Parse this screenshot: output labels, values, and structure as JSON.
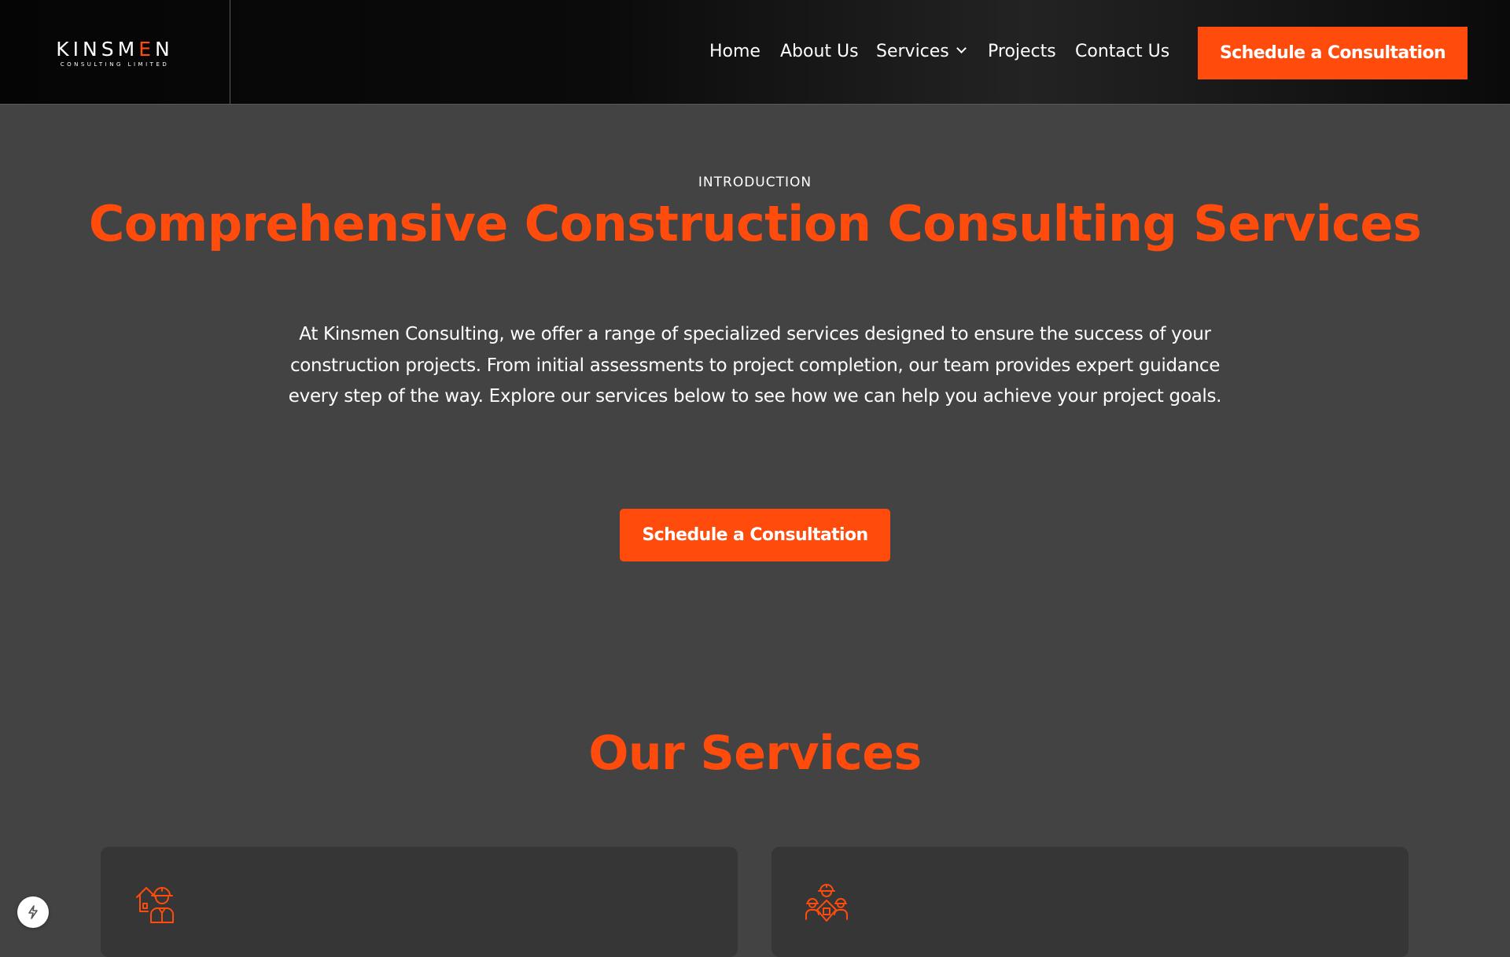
{
  "header": {
    "logo": {
      "word_start": "KINSM",
      "word_mid": "E",
      "word_end": "N",
      "tagline": "CONSULTING LIMITED"
    },
    "nav": [
      {
        "label": "Home"
      },
      {
        "label": "About Us"
      },
      {
        "label": "Services",
        "icon": "chevron-down-icon"
      },
      {
        "label": "Projects"
      },
      {
        "label": "Contact Us"
      }
    ],
    "cta_label": "Schedule a Consultation"
  },
  "hero": {
    "eyebrow": "INTRODUCTION",
    "title": "Comprehensive Construction Consulting Services",
    "paragraph": "At Kinsmen Consulting, we offer a range of specialized services designed to ensure the success of your construction projects. From initial assessments to project completion, our team provides expert guidance every step of the way. Explore our services below to see how we can help you achieve your project goals.",
    "cta_label": "Schedule a Consultation"
  },
  "services": {
    "title": "Our Services",
    "cards": [
      {
        "icon": "construction-worker-house-icon"
      },
      {
        "icon": "construction-team-icon"
      }
    ]
  },
  "floating_button": {
    "icon": "lightning-icon"
  },
  "colors": {
    "accent": "#ff4b0c",
    "background": "#434343",
    "header_bg": "#0a0a0a",
    "card_bg": "#363636",
    "text": "#ffffff"
  }
}
